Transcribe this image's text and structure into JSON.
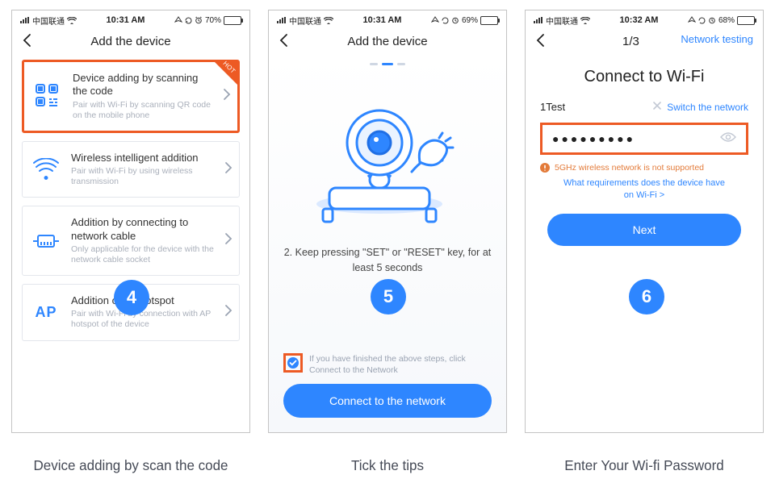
{
  "colors": {
    "accent": "#2e86ff",
    "highlight": "#ed5a24"
  },
  "phone1": {
    "status": {
      "carrier": "中国联通",
      "time": "10:31 AM",
      "battery_text": "70%",
      "battery_fill": 0.7
    },
    "title": "Add the device",
    "hot_badge_label": "HOT",
    "options": [
      {
        "key": "qr",
        "title": "Device adding by scanning the code",
        "subtitle": "Pair with Wi-Fi by scanning QR code on the mobile phone",
        "highlight": true,
        "hot": true
      },
      {
        "key": "wireless",
        "title": "Wireless intelligent addition",
        "subtitle": "Pair with Wi-Fi by using wireless transmission"
      },
      {
        "key": "cable",
        "title": "Addition by connecting to network cable",
        "subtitle": "Only applicable for the device with the network cable socket"
      },
      {
        "key": "ap",
        "title": "Addition of AP hotspot",
        "subtitle": "Pair with Wi-Fi by connection with AP hotspot of the device"
      }
    ],
    "step_number": "4"
  },
  "phone2": {
    "status": {
      "carrier": "中国联通",
      "time": "10:31 AM",
      "battery_text": "69%",
      "battery_fill": 0.69
    },
    "title": "Add the device",
    "instruction": "2. Keep pressing \"SET\" or \"RESET\" key, for at least 5 seconds",
    "tick_text": "If you have finished the above steps, click Connect to the Network",
    "connect_button": "Connect to the network",
    "step_number": "5"
  },
  "phone3": {
    "status": {
      "carrier": "中国联通",
      "time": "10:32 AM",
      "battery_text": "68%",
      "battery_fill": 0.68
    },
    "step_indicator": "1/3",
    "top_right_link": "Network testing",
    "heading": "Connect to Wi-Fi",
    "network_name": "1Test",
    "switch_label": "Switch the network",
    "password_mask": "●●●●●●●●●",
    "warning": "5GHz wireless network is not supported",
    "requirements_link": "What requirements does the device have on Wi-Fi >",
    "next_button": "Next",
    "step_number": "6"
  },
  "captions": {
    "c1": "Device adding by scan the code",
    "c2": "Tick the tips",
    "c3": "Enter Your Wi-fi Password"
  }
}
